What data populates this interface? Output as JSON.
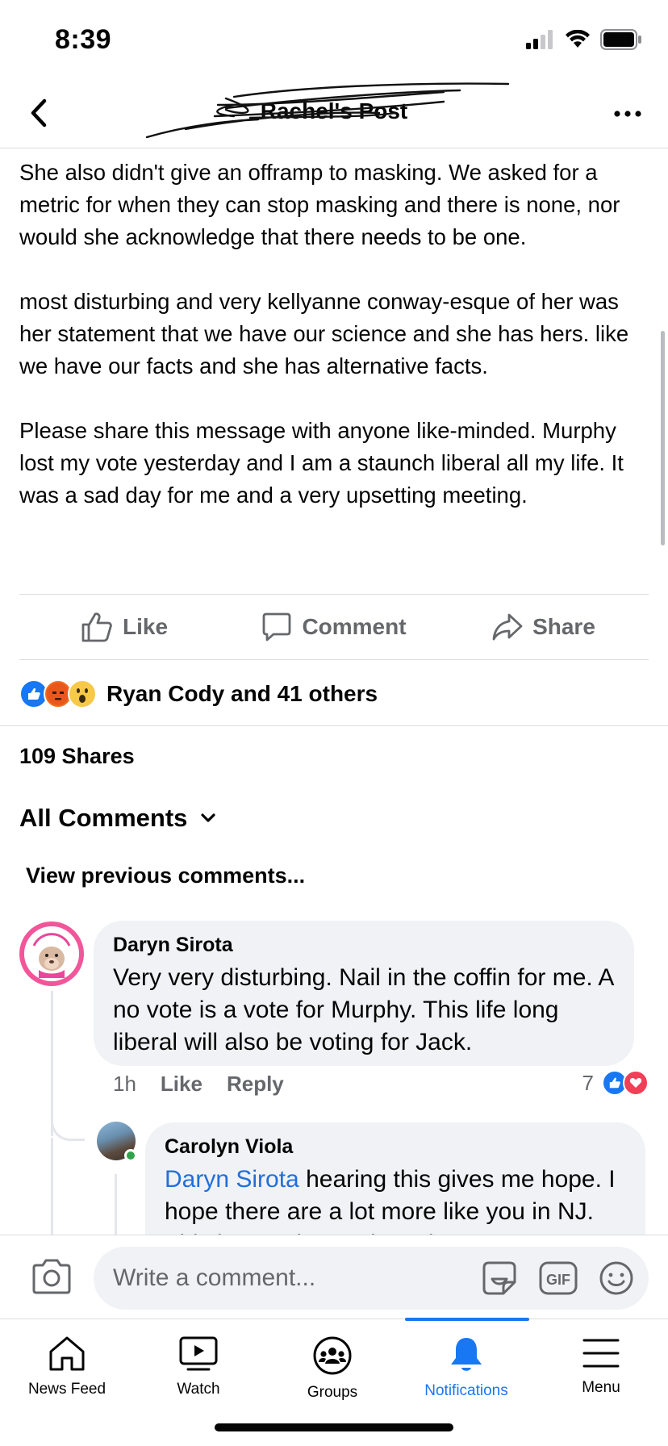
{
  "status_bar": {
    "time": "8:39"
  },
  "header": {
    "title": "Rachel's Post"
  },
  "post": {
    "paragraphs": [
      "She also didn't give an offramp to masking. We asked for a metric for when they can stop masking and there is none, nor would she acknowledge that there needs to be one.",
      "most disturbing and very kellyanne conway-esque of her was her statement that we have our science and she has hers. like we have our facts and she has alternative facts.",
      "Please share this message with anyone like-minded. Murphy lost my vote yesterday and I am a staunch liberal all my life. It was a sad day for me and a very upsetting meeting."
    ]
  },
  "actions": {
    "like": "Like",
    "comment": "Comment",
    "share": "Share"
  },
  "reactions": {
    "text": "Ryan Cody and 41 others",
    "icons": [
      "like-icon",
      "angry-icon",
      "wow-icon"
    ]
  },
  "shares": "109 Shares",
  "comments_section": {
    "title": "All Comments",
    "view_previous": "View previous comments...",
    "comments": [
      {
        "author": "Daryn Sirota",
        "text": "Very very disturbing. Nail in the coffin for me. A no vote is a vote for Murphy. This life long liberal will also be voting for Jack.",
        "time": "1h",
        "like_label": "Like",
        "reply_label": "Reply",
        "reaction_count": "7"
      },
      {
        "author": "Carolyn Viola",
        "mention": "Daryn Sirota",
        "text": " hearing this gives me hope. I hope there are a lot more like you in NJ. This is overdue and continues to"
      }
    ]
  },
  "composer": {
    "placeholder": "Write a comment..."
  },
  "tabs": [
    {
      "label": "News Feed"
    },
    {
      "label": "Watch"
    },
    {
      "label": "Groups"
    },
    {
      "label": "Notifications"
    },
    {
      "label": "Menu"
    }
  ],
  "colors": {
    "accent": "#1877f2",
    "secondary_text": "#65676b",
    "bubble": "#f0f2f5"
  }
}
